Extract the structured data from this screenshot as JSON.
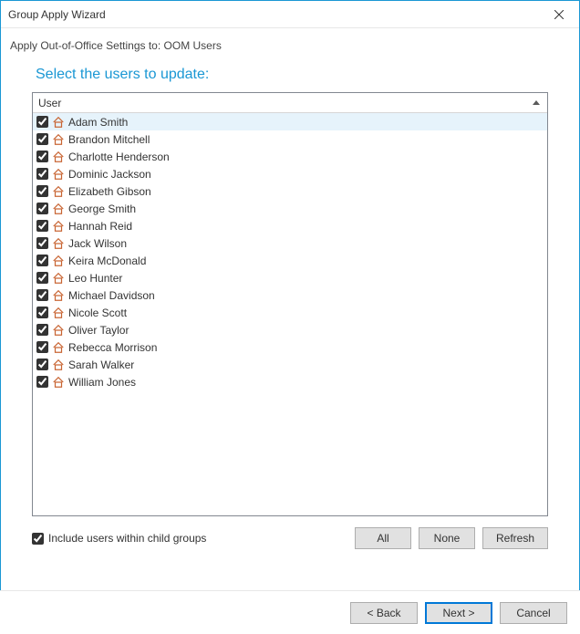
{
  "window": {
    "title": "Group Apply Wizard"
  },
  "subtitle": "Apply Out-of-Office Settings to: OOM Users",
  "heading": "Select the users to update:",
  "list": {
    "column_header": "User",
    "users": [
      {
        "name": "Adam Smith",
        "checked": true,
        "selected": true
      },
      {
        "name": "Brandon Mitchell",
        "checked": true,
        "selected": false
      },
      {
        "name": "Charlotte Henderson",
        "checked": true,
        "selected": false
      },
      {
        "name": "Dominic Jackson",
        "checked": true,
        "selected": false
      },
      {
        "name": "Elizabeth Gibson",
        "checked": true,
        "selected": false
      },
      {
        "name": "George Smith",
        "checked": true,
        "selected": false
      },
      {
        "name": "Hannah Reid",
        "checked": true,
        "selected": false
      },
      {
        "name": "Jack Wilson",
        "checked": true,
        "selected": false
      },
      {
        "name": "Keira McDonald",
        "checked": true,
        "selected": false
      },
      {
        "name": "Leo Hunter",
        "checked": true,
        "selected": false
      },
      {
        "name": "Michael Davidson",
        "checked": true,
        "selected": false
      },
      {
        "name": "Nicole Scott",
        "checked": true,
        "selected": false
      },
      {
        "name": "Oliver Taylor",
        "checked": true,
        "selected": false
      },
      {
        "name": "Rebecca Morrison",
        "checked": true,
        "selected": false
      },
      {
        "name": "Sarah Walker",
        "checked": true,
        "selected": false
      },
      {
        "name": "William Jones",
        "checked": true,
        "selected": false
      }
    ]
  },
  "include_child_groups": {
    "label": "Include users within child groups",
    "checked": true
  },
  "buttons": {
    "all": "All",
    "none": "None",
    "refresh": "Refresh",
    "back": "< Back",
    "next": "Next >",
    "cancel": "Cancel"
  }
}
